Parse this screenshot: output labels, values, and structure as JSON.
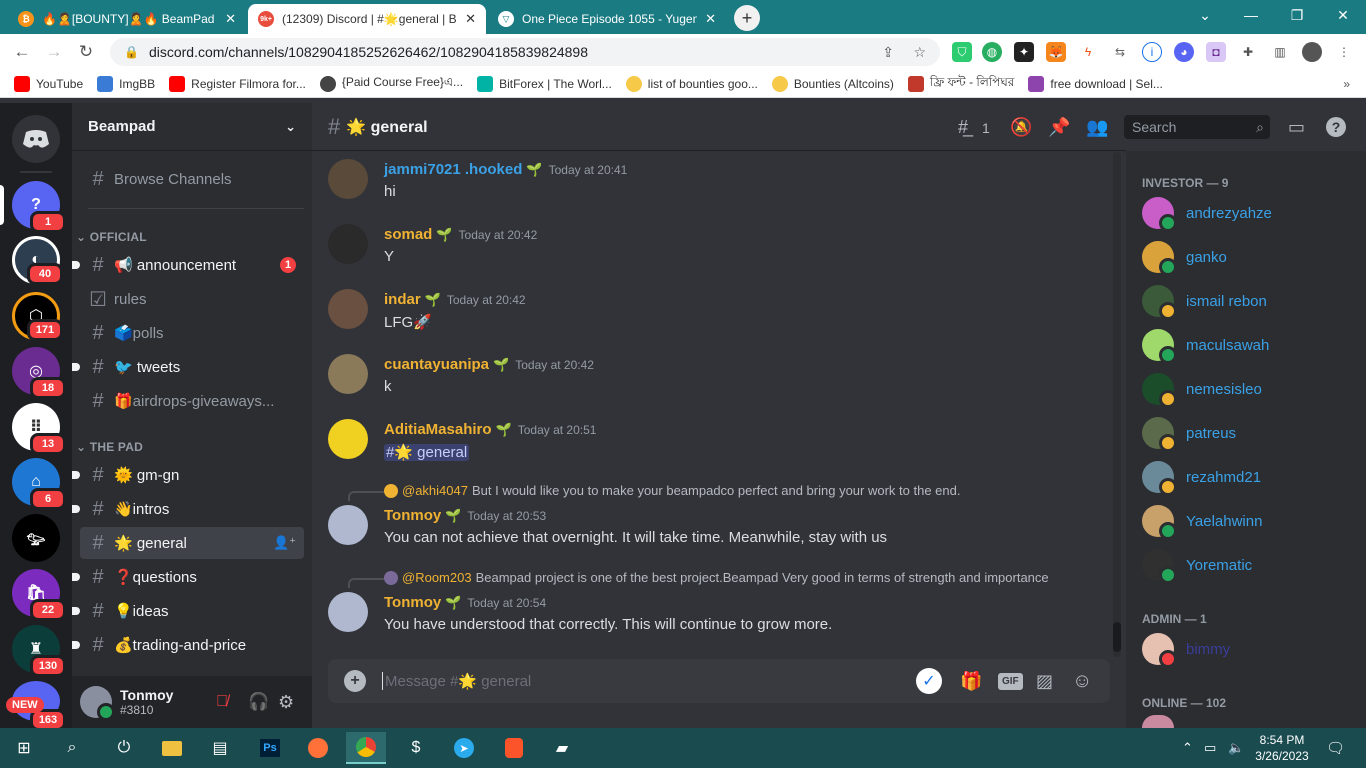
{
  "browser": {
    "tabs": [
      {
        "title": "🔥🙎[BOUNTY]🙎🔥 BeamPad - ⬛",
        "icon": "bitcoin-icon",
        "color": "#f7931a"
      },
      {
        "title": "(12309) Discord | #🌟general | Be",
        "icon": "discord-icon",
        "color": "#e74c3c",
        "active": true
      },
      {
        "title": "One Piece Episode 1055 - Yugen",
        "icon": "yugen-icon",
        "color": "#1a7b83"
      }
    ],
    "url": "discord.com/channels/1082904185252626462/1082904185839824898",
    "bookmarks": [
      {
        "label": "YouTube",
        "color": "#ff0000"
      },
      {
        "label": "ImgBB",
        "color": "#3a7bd5"
      },
      {
        "label": "Register Filmora for...",
        "color": "#ff0000"
      },
      {
        "label": "{Paid Course Free}এ...",
        "color": "#444444"
      },
      {
        "label": "BitForex | The Worl...",
        "color": "#00b3a4"
      },
      {
        "label": "list of bounties goo...",
        "color": "#f7c948"
      },
      {
        "label": "Bounties (Altcoins)",
        "color": "#f7c948"
      },
      {
        "label": "ফ্রি ফন্ট - লিপিঘর",
        "color": "#c0392b"
      },
      {
        "label": "free download | Sel...",
        "color": "#8e44ad"
      }
    ]
  },
  "server": {
    "name": "Beampad",
    "browse": "Browse Channels",
    "categories": [
      {
        "name": "OFFICIAL",
        "channels": [
          {
            "label": "📢 announcement",
            "badge": "1",
            "unread": true
          },
          {
            "label": "rules",
            "unread": false
          },
          {
            "label": "🗳️polls",
            "unread": false
          },
          {
            "label": "🐦 tweets",
            "unread": true
          },
          {
            "label": "🎁airdrops-giveaways...",
            "unread": false
          }
        ]
      },
      {
        "name": "THE PAD",
        "channels": [
          {
            "label": "🌞 gm-gn",
            "unread": true
          },
          {
            "label": "👋intros",
            "unread": true
          },
          {
            "label": "🌟 general",
            "selected": true
          },
          {
            "label": "❓questions",
            "unread": true
          },
          {
            "label": "💡ideas",
            "unread": true
          },
          {
            "label": "💰trading-and-price",
            "unread": true
          }
        ]
      }
    ]
  },
  "guilds": [
    {
      "badge": "1",
      "color": "#5865f2"
    },
    {
      "badge": "40",
      "color": "#2c3e50"
    },
    {
      "badge": "171",
      "color": "#000000"
    },
    {
      "badge": "18",
      "color": "#6a2c91"
    },
    {
      "badge": "13",
      "color": "#ffffff"
    },
    {
      "badge": "6",
      "color": "#1f77d4"
    },
    {
      "badge": "",
      "color": "#000000"
    },
    {
      "badge": "22",
      "color": "#7b2cbf"
    },
    {
      "badge": "130",
      "color": "#0b3d3a"
    },
    {
      "badge": "163",
      "color": "#5865f2",
      "new": "NEW"
    }
  ],
  "user": {
    "name": "Tonmoy",
    "tag": "#3810"
  },
  "channel": {
    "title": "🌟 general",
    "threads": "1",
    "search": "Search",
    "placeholder": "Message #🌟 general"
  },
  "messages": [
    {
      "author": "jammi7021 .hooked",
      "time": "Today at 20:41",
      "text": "hi",
      "color": "#3ba1e6"
    },
    {
      "author": "somad",
      "time": "Today at 20:42",
      "text": "Y",
      "color": "#f0b232"
    },
    {
      "author": "indar",
      "time": "Today at 20:42",
      "text": "LFG🚀",
      "color": "#f0b232"
    },
    {
      "author": "cuantayuanipa",
      "time": "Today at 20:42",
      "text": "k",
      "color": "#f0b232"
    },
    {
      "author": "AditiaMasahiro",
      "time": "Today at 20:51",
      "text": "#🌟 general",
      "color": "#f0b232"
    },
    {
      "author": "Tonmoy",
      "time": "Today at 20:53",
      "text": "You can not achieve that overnight. It will take time. Meanwhile, stay with us",
      "color": "#f0b232",
      "reply_user": "@akhi4047",
      "reply_text": "But I would like you to make your beampadco perfect and bring your work to the end."
    },
    {
      "author": "Tonmoy",
      "time": "Today at 20:54",
      "text": "You have understood that correctly. This will continue to grow more.",
      "color": "#f0b232",
      "reply_user": "@Room203",
      "reply_text": "Beampad project is one of the best project.Beampad Very good in terms of strength and importance"
    }
  ],
  "members": {
    "investor_header": "INVESTOR — 9",
    "investors": [
      {
        "name": "andrezyahze",
        "status": "#23a55a",
        "avatar": "#c95ec9"
      },
      {
        "name": "ganko",
        "status": "#23a55a",
        "avatar": "#d9a23b"
      },
      {
        "name": "ismail rebon",
        "status": "#f0b232",
        "avatar": "#3a5a3a"
      },
      {
        "name": "maculsawah",
        "status": "#23a55a",
        "avatar": "#9fd86b"
      },
      {
        "name": "nemesisleo",
        "status": "#f0b232",
        "avatar": "#1b4d2b"
      },
      {
        "name": "patreus",
        "status": "#f0b232",
        "avatar": "#5a6a4a"
      },
      {
        "name": "rezahmd21",
        "status": "#f0b232",
        "avatar": "#6a8a9a"
      },
      {
        "name": "Yaelahwinn",
        "status": "#23a55a",
        "avatar": "#c8a06a"
      },
      {
        "name": "Yorematic",
        "status": "#23a55a",
        "avatar": "#303030"
      }
    ],
    "admin_header": "ADMIN — 1",
    "admins": [
      {
        "name": "bimmy",
        "status": "#f23f42",
        "avatar": "#e6c0b0"
      }
    ],
    "online_header": "ONLINE — 102"
  },
  "taskbar": {
    "time": "8:54 PM",
    "date": "3/26/2023"
  }
}
